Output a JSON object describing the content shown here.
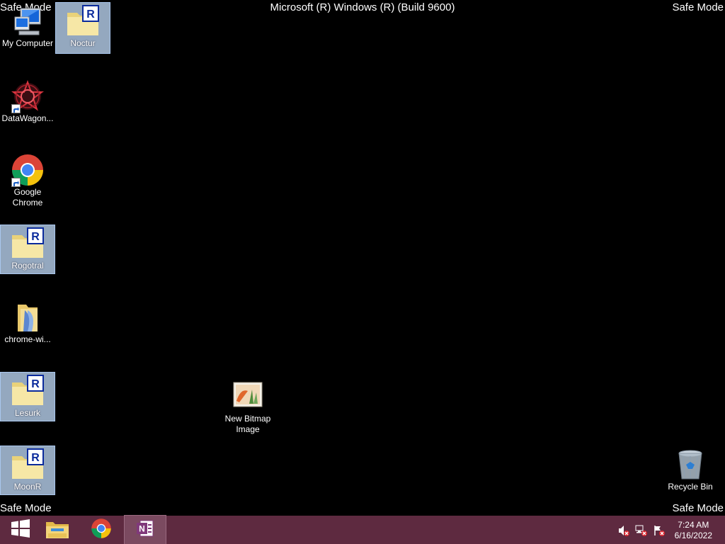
{
  "watermarks": {
    "top_left": "Safe Mode",
    "top_right": "Safe Mode",
    "bottom_left": "Safe Mode",
    "bottom_right": "Safe Mode",
    "build": "Microsoft (R) Windows (R) (Build 9600)"
  },
  "desktop": {
    "icons": [
      {
        "label": "My Computer",
        "icon": "computer-icon"
      },
      {
        "label": "Noctur",
        "icon": "folder-r-icon",
        "selected": true
      },
      {
        "label": "DataWagon...",
        "icon": "datawagon-icon",
        "shortcut": true
      },
      {
        "label": "Google Chrome",
        "icon": "chrome-icon",
        "shortcut": true
      },
      {
        "label": "Rogotral",
        "icon": "folder-r-icon",
        "selected": true
      },
      {
        "label": "chrome-wi...",
        "icon": "zip-folder-icon"
      },
      {
        "label": "Lesurk",
        "icon": "folder-r-icon",
        "selected": true
      },
      {
        "label": "MoonR",
        "icon": "folder-r-icon",
        "selected": true
      },
      {
        "label": "New Bitmap Image",
        "icon": "bitmap-icon"
      },
      {
        "label": "Recycle Bin",
        "icon": "recycle-bin-icon"
      }
    ]
  },
  "taskbar": {
    "start_icon": "windows-start-icon",
    "pinned": [
      "file-explorer-icon",
      "chrome-icon",
      "onenote-icon"
    ],
    "tray": [
      "volume-muted-icon",
      "network-error-icon",
      "action-center-flag-icon"
    ],
    "time": "7:24 AM",
    "date": "6/16/2022",
    "colors": {
      "bar": "#5e2a40",
      "active": "#7b4a60"
    }
  }
}
